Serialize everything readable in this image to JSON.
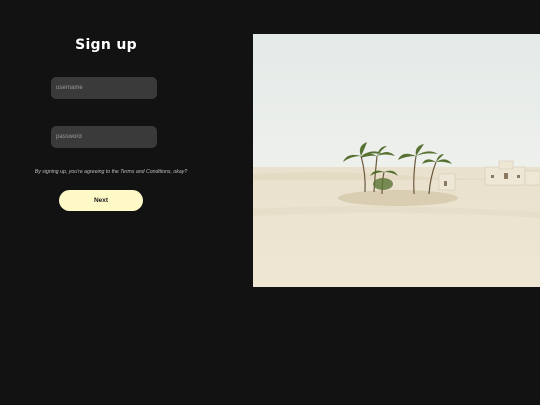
{
  "form": {
    "title": "Sign up",
    "username_placeholder": "username",
    "password_placeholder": "password",
    "terms_text": "By signing up, you're agreeing to the Terms and Conditions, okay?",
    "next_label": "Next"
  },
  "image": {
    "sky_color": "#e7ebe8",
    "sand_color": "#ece3ce",
    "palm_color": "#4f6b2a"
  }
}
